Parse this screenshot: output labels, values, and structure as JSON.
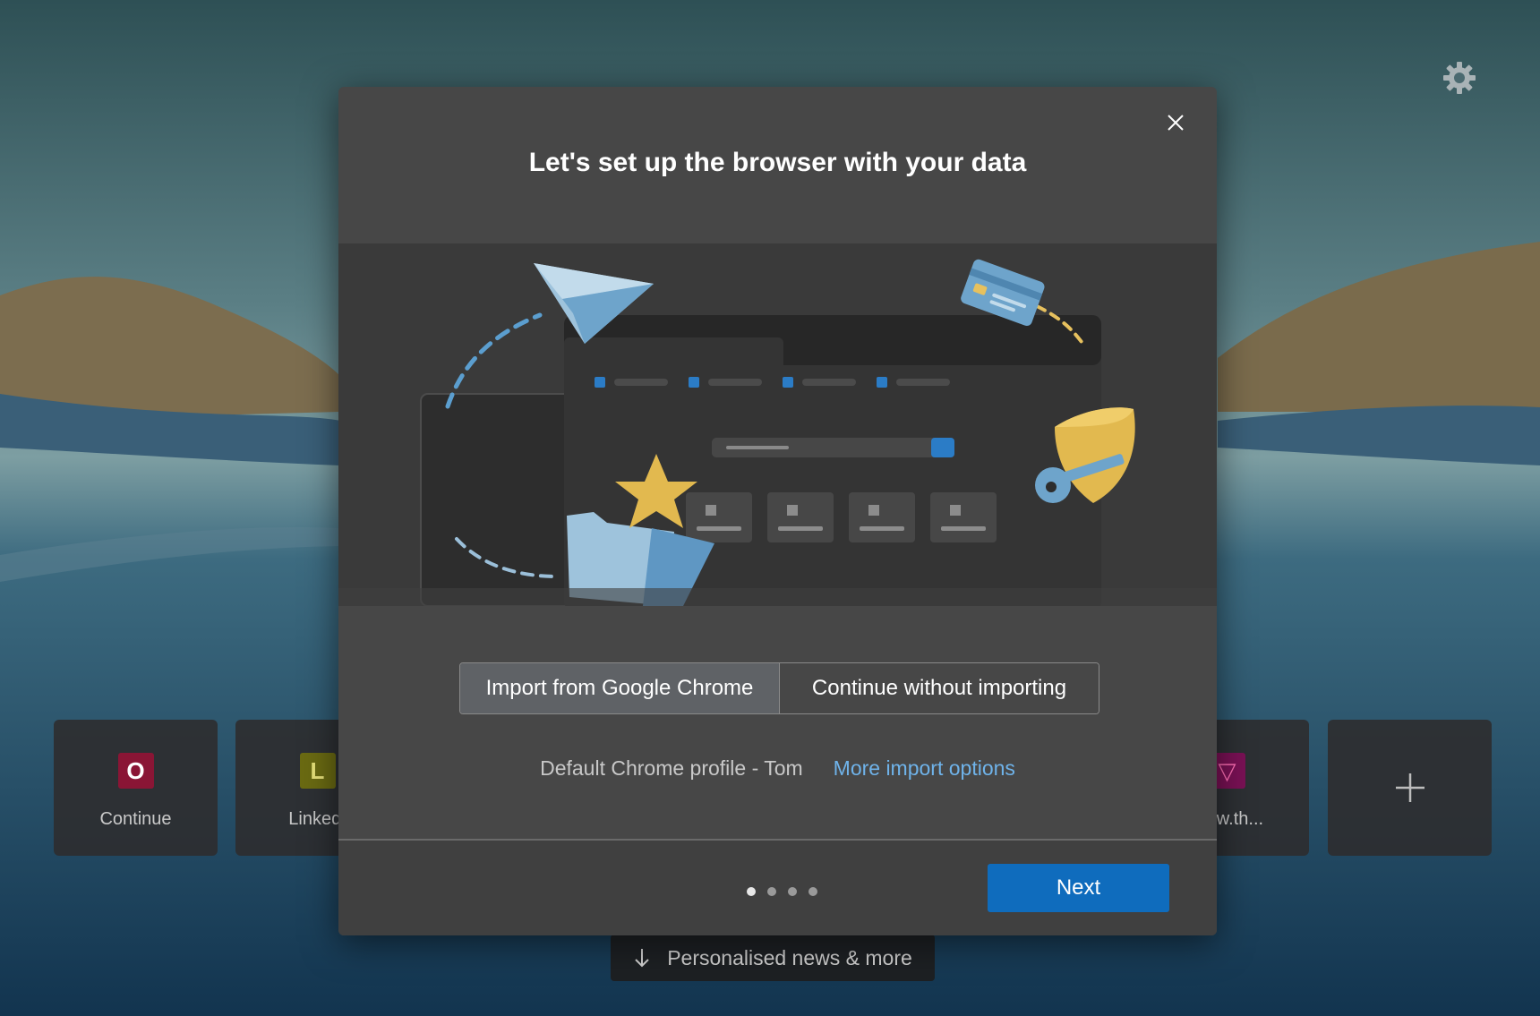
{
  "colors": {
    "accent": "#0f6cbd",
    "link": "#6fb3ea",
    "dialog_bg": "#474747",
    "hero_bg": "#3a3a3a"
  },
  "background": {
    "settings_icon": "gear-icon"
  },
  "tiles": [
    {
      "letter": "O",
      "label": "Continue",
      "badge_color": "#8a1535"
    },
    {
      "letter": "L",
      "label": "LinkedI",
      "badge_color": "#6a6a12"
    },
    {
      "letter": "▽",
      "label": "www.th...",
      "badge_color": "#7a1155"
    }
  ],
  "add_tile": {
    "icon": "plus-icon"
  },
  "news": {
    "label": "Personalised news & more",
    "icon": "arrow-down-icon"
  },
  "dialog": {
    "title": "Let's set up the browser with your data",
    "close_icon": "close-icon",
    "import_button": "Import from Google Chrome",
    "skip_button": "Continue without importing",
    "profile_text": "Default Chrome profile - Tom",
    "more_link": "More import options",
    "steps": {
      "current": 1,
      "total": 4
    },
    "next_button": "Next"
  }
}
